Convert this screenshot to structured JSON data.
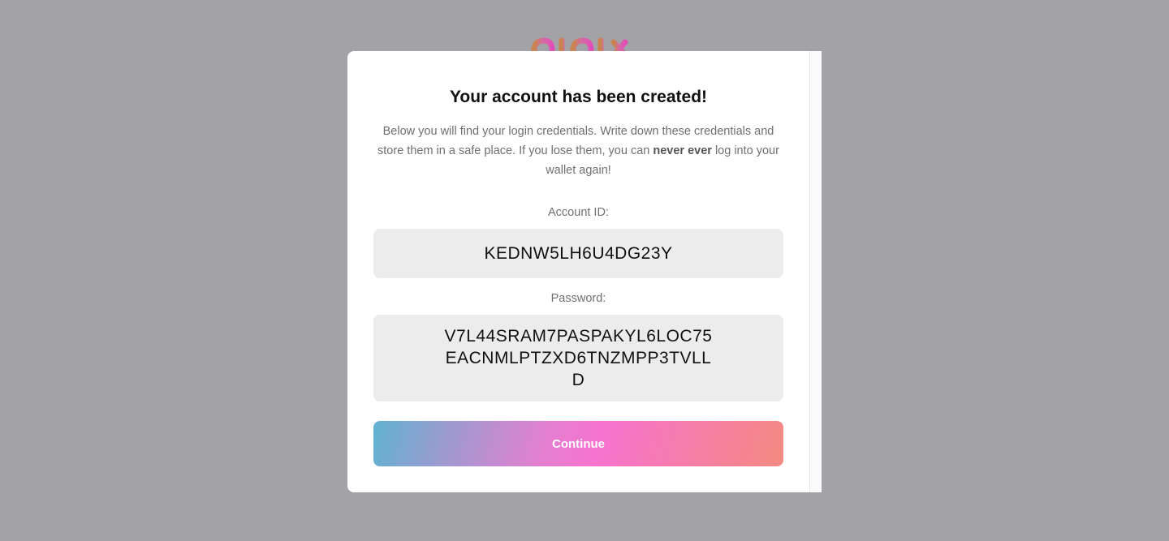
{
  "brand": {
    "logo_icon": "brand-logo",
    "logo_colors": [
      "#c9864c",
      "#d66aa6",
      "#e04fb6"
    ]
  },
  "modal": {
    "title": "Your account has been created!",
    "intro": {
      "before": "Below you will find your login credentials. Write down these credentials and store them in a safe place. If you lose them, you can ",
      "emphasis": "never ever",
      "after": " log into your wallet again!"
    },
    "account_id": {
      "label": "Account ID:",
      "value": "KEDNW5LH6U4DG23Y"
    },
    "password": {
      "label": "Password:",
      "value": "V7L44SRAM7PASPAKYL6LOC75EACNMLPTZXD6TNZMPP3TVLLD"
    },
    "continue_label": "Continue"
  },
  "colors": {
    "backdrop": "#a3a2a7",
    "field_background": "#ececec",
    "button_gradient": [
      "#5fb2d0",
      "#f673cf",
      "#f48b82"
    ]
  }
}
